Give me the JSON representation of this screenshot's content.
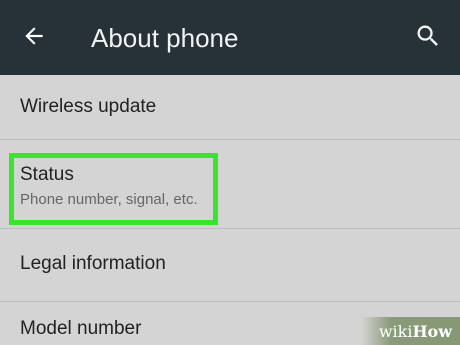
{
  "colors": {
    "app_bar": "#263238",
    "background": "#d4d4d4",
    "highlight": "#39e52c",
    "divider": "#bdbdbd"
  },
  "app_bar": {
    "back_icon": "arrow-back-icon",
    "title": "About phone",
    "search_icon": "search-icon"
  },
  "items": [
    {
      "title": "Wireless update",
      "subtitle": ""
    },
    {
      "title": "Status",
      "subtitle": "Phone number, signal, etc."
    },
    {
      "title": "Legal information",
      "subtitle": ""
    },
    {
      "title": "Model number",
      "subtitle": ""
    }
  ],
  "watermark": {
    "wiki": "wiki",
    "how": "How"
  }
}
